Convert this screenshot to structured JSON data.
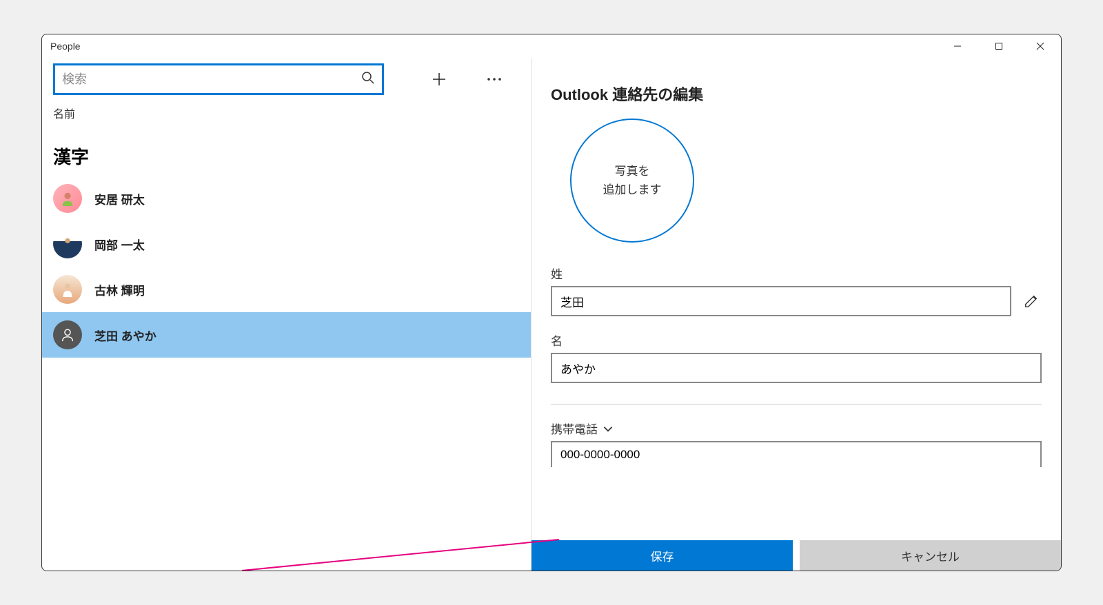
{
  "window": {
    "title": "People"
  },
  "search": {
    "placeholder": "検索"
  },
  "sort_label": "名前",
  "section_header": "漢字",
  "contacts": [
    {
      "name": "安居 研太"
    },
    {
      "name": "岡部 一太"
    },
    {
      "name": "古林 輝明"
    },
    {
      "name": "芝田 あやか"
    }
  ],
  "editor": {
    "title": "Outlook 連絡先の編集",
    "add_photo_label": "写真を\n追加します",
    "surname_label": "姓",
    "surname_value": "芝田",
    "given_label": "名",
    "given_value": "あやか",
    "phone_type_label": "携帯電話",
    "phone_value": "000-0000-0000",
    "save_label": "保存",
    "cancel_label": "キャンセル"
  }
}
